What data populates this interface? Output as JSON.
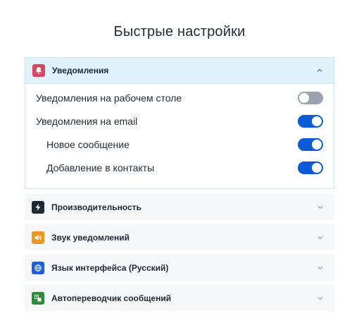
{
  "page": {
    "title": "Быстрые настройки"
  },
  "notifications": {
    "label": "Уведомления",
    "icon": "bell-icon",
    "icon_color": "#d9465f",
    "expanded": true,
    "rows": [
      {
        "label": "Уведомления на рабочем столе",
        "on": false
      },
      {
        "label": "Уведомления на email",
        "on": true
      },
      {
        "label": "Новое сообщение",
        "on": true
      },
      {
        "label": "Добавление в контакты",
        "on": true
      }
    ]
  },
  "sections": [
    {
      "label": "Производительность",
      "icon": "lightning-icon",
      "icon_color": "#1f2937"
    },
    {
      "label": "Звук уведомлений",
      "icon": "speaker-icon",
      "icon_color": "#f0961e"
    },
    {
      "label": "Язык интерфейса (Русский)",
      "icon": "globe-icon",
      "icon_color": "#1e5fe0"
    },
    {
      "label": "Автопереводчик сообщений",
      "icon": "translate-icon",
      "icon_color": "#2e8b3a"
    }
  ],
  "colors": {
    "toggle_on": "#0b5bd7",
    "toggle_off": "#9ca3af",
    "expanded_header_bg": "#dff1fb"
  }
}
